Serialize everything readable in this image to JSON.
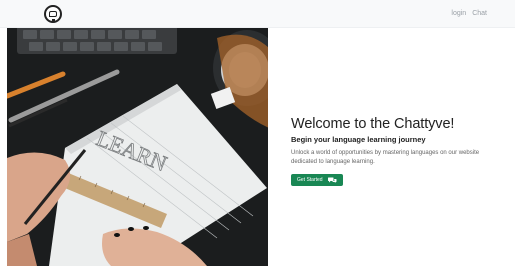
{
  "navbar": {
    "logo_icon": "chat-bubble-logo-icon",
    "links": [
      "login",
      "Chat"
    ]
  },
  "hero": {
    "image_icon": "learn-notebook-photo",
    "title": "Welcome to the Chattyve!",
    "subtitle": "Begin your language learning journey",
    "description": "Unlock a world of opportunities by mastering languages on our website dedicated to language learning.",
    "cta_label": "Get Started",
    "cta_icon": "chat-bubbles-icon"
  },
  "colors": {
    "navbar_bg": "#f8f9fa",
    "cta_bg": "#198754",
    "title_text": "#222222",
    "link_text": "#9aa0a6"
  }
}
